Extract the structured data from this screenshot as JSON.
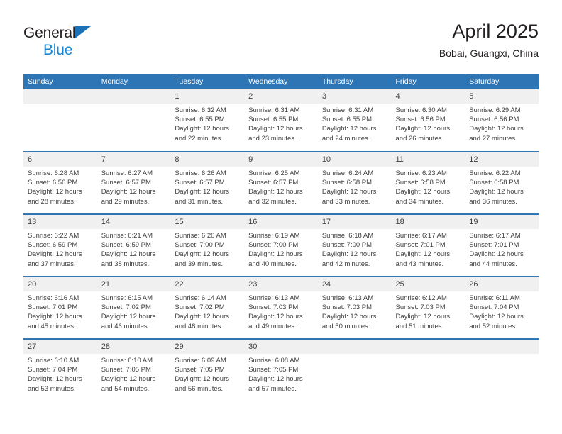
{
  "brand": {
    "line1": "General",
    "line2": "Blue",
    "triangle_icon": "brand-triangle-icon",
    "accent_color": "#1b87d4"
  },
  "header": {
    "title": "April 2025",
    "subtitle": "Bobai, Guangxi, China"
  },
  "colors": {
    "header_bar": "#2e75b6",
    "daynum_band": "#f0f0f0",
    "text": "#3f3f3f"
  },
  "calendar": {
    "weekday_headers": [
      "Sunday",
      "Monday",
      "Tuesday",
      "Wednesday",
      "Thursday",
      "Friday",
      "Saturday"
    ],
    "weeks": [
      [
        {
          "day": "",
          "empty": true,
          "sunrise": "",
          "sunset": "",
          "daylight1": "",
          "daylight2": ""
        },
        {
          "day": "",
          "empty": true,
          "sunrise": "",
          "sunset": "",
          "daylight1": "",
          "daylight2": ""
        },
        {
          "day": "1",
          "sunrise": "Sunrise: 6:32 AM",
          "sunset": "Sunset: 6:55 PM",
          "daylight1": "Daylight: 12 hours",
          "daylight2": "and 22 minutes."
        },
        {
          "day": "2",
          "sunrise": "Sunrise: 6:31 AM",
          "sunset": "Sunset: 6:55 PM",
          "daylight1": "Daylight: 12 hours",
          "daylight2": "and 23 minutes."
        },
        {
          "day": "3",
          "sunrise": "Sunrise: 6:31 AM",
          "sunset": "Sunset: 6:55 PM",
          "daylight1": "Daylight: 12 hours",
          "daylight2": "and 24 minutes."
        },
        {
          "day": "4",
          "sunrise": "Sunrise: 6:30 AM",
          "sunset": "Sunset: 6:56 PM",
          "daylight1": "Daylight: 12 hours",
          "daylight2": "and 26 minutes."
        },
        {
          "day": "5",
          "sunrise": "Sunrise: 6:29 AM",
          "sunset": "Sunset: 6:56 PM",
          "daylight1": "Daylight: 12 hours",
          "daylight2": "and 27 minutes."
        }
      ],
      [
        {
          "day": "6",
          "sunrise": "Sunrise: 6:28 AM",
          "sunset": "Sunset: 6:56 PM",
          "daylight1": "Daylight: 12 hours",
          "daylight2": "and 28 minutes."
        },
        {
          "day": "7",
          "sunrise": "Sunrise: 6:27 AM",
          "sunset": "Sunset: 6:57 PM",
          "daylight1": "Daylight: 12 hours",
          "daylight2": "and 29 minutes."
        },
        {
          "day": "8",
          "sunrise": "Sunrise: 6:26 AM",
          "sunset": "Sunset: 6:57 PM",
          "daylight1": "Daylight: 12 hours",
          "daylight2": "and 31 minutes."
        },
        {
          "day": "9",
          "sunrise": "Sunrise: 6:25 AM",
          "sunset": "Sunset: 6:57 PM",
          "daylight1": "Daylight: 12 hours",
          "daylight2": "and 32 minutes."
        },
        {
          "day": "10",
          "sunrise": "Sunrise: 6:24 AM",
          "sunset": "Sunset: 6:58 PM",
          "daylight1": "Daylight: 12 hours",
          "daylight2": "and 33 minutes."
        },
        {
          "day": "11",
          "sunrise": "Sunrise: 6:23 AM",
          "sunset": "Sunset: 6:58 PM",
          "daylight1": "Daylight: 12 hours",
          "daylight2": "and 34 minutes."
        },
        {
          "day": "12",
          "sunrise": "Sunrise: 6:22 AM",
          "sunset": "Sunset: 6:58 PM",
          "daylight1": "Daylight: 12 hours",
          "daylight2": "and 36 minutes."
        }
      ],
      [
        {
          "day": "13",
          "sunrise": "Sunrise: 6:22 AM",
          "sunset": "Sunset: 6:59 PM",
          "daylight1": "Daylight: 12 hours",
          "daylight2": "and 37 minutes."
        },
        {
          "day": "14",
          "sunrise": "Sunrise: 6:21 AM",
          "sunset": "Sunset: 6:59 PM",
          "daylight1": "Daylight: 12 hours",
          "daylight2": "and 38 minutes."
        },
        {
          "day": "15",
          "sunrise": "Sunrise: 6:20 AM",
          "sunset": "Sunset: 7:00 PM",
          "daylight1": "Daylight: 12 hours",
          "daylight2": "and 39 minutes."
        },
        {
          "day": "16",
          "sunrise": "Sunrise: 6:19 AM",
          "sunset": "Sunset: 7:00 PM",
          "daylight1": "Daylight: 12 hours",
          "daylight2": "and 40 minutes."
        },
        {
          "day": "17",
          "sunrise": "Sunrise: 6:18 AM",
          "sunset": "Sunset: 7:00 PM",
          "daylight1": "Daylight: 12 hours",
          "daylight2": "and 42 minutes."
        },
        {
          "day": "18",
          "sunrise": "Sunrise: 6:17 AM",
          "sunset": "Sunset: 7:01 PM",
          "daylight1": "Daylight: 12 hours",
          "daylight2": "and 43 minutes."
        },
        {
          "day": "19",
          "sunrise": "Sunrise: 6:17 AM",
          "sunset": "Sunset: 7:01 PM",
          "daylight1": "Daylight: 12 hours",
          "daylight2": "and 44 minutes."
        }
      ],
      [
        {
          "day": "20",
          "sunrise": "Sunrise: 6:16 AM",
          "sunset": "Sunset: 7:01 PM",
          "daylight1": "Daylight: 12 hours",
          "daylight2": "and 45 minutes."
        },
        {
          "day": "21",
          "sunrise": "Sunrise: 6:15 AM",
          "sunset": "Sunset: 7:02 PM",
          "daylight1": "Daylight: 12 hours",
          "daylight2": "and 46 minutes."
        },
        {
          "day": "22",
          "sunrise": "Sunrise: 6:14 AM",
          "sunset": "Sunset: 7:02 PM",
          "daylight1": "Daylight: 12 hours",
          "daylight2": "and 48 minutes."
        },
        {
          "day": "23",
          "sunrise": "Sunrise: 6:13 AM",
          "sunset": "Sunset: 7:03 PM",
          "daylight1": "Daylight: 12 hours",
          "daylight2": "and 49 minutes."
        },
        {
          "day": "24",
          "sunrise": "Sunrise: 6:13 AM",
          "sunset": "Sunset: 7:03 PM",
          "daylight1": "Daylight: 12 hours",
          "daylight2": "and 50 minutes."
        },
        {
          "day": "25",
          "sunrise": "Sunrise: 6:12 AM",
          "sunset": "Sunset: 7:03 PM",
          "daylight1": "Daylight: 12 hours",
          "daylight2": "and 51 minutes."
        },
        {
          "day": "26",
          "sunrise": "Sunrise: 6:11 AM",
          "sunset": "Sunset: 7:04 PM",
          "daylight1": "Daylight: 12 hours",
          "daylight2": "and 52 minutes."
        }
      ],
      [
        {
          "day": "27",
          "sunrise": "Sunrise: 6:10 AM",
          "sunset": "Sunset: 7:04 PM",
          "daylight1": "Daylight: 12 hours",
          "daylight2": "and 53 minutes."
        },
        {
          "day": "28",
          "sunrise": "Sunrise: 6:10 AM",
          "sunset": "Sunset: 7:05 PM",
          "daylight1": "Daylight: 12 hours",
          "daylight2": "and 54 minutes."
        },
        {
          "day": "29",
          "sunrise": "Sunrise: 6:09 AM",
          "sunset": "Sunset: 7:05 PM",
          "daylight1": "Daylight: 12 hours",
          "daylight2": "and 56 minutes."
        },
        {
          "day": "30",
          "sunrise": "Sunrise: 6:08 AM",
          "sunset": "Sunset: 7:05 PM",
          "daylight1": "Daylight: 12 hours",
          "daylight2": "and 57 minutes."
        },
        {
          "day": "",
          "empty": true,
          "sunrise": "",
          "sunset": "",
          "daylight1": "",
          "daylight2": ""
        },
        {
          "day": "",
          "empty": true,
          "sunrise": "",
          "sunset": "",
          "daylight1": "",
          "daylight2": ""
        },
        {
          "day": "",
          "empty": true,
          "sunrise": "",
          "sunset": "",
          "daylight1": "",
          "daylight2": ""
        }
      ]
    ]
  }
}
